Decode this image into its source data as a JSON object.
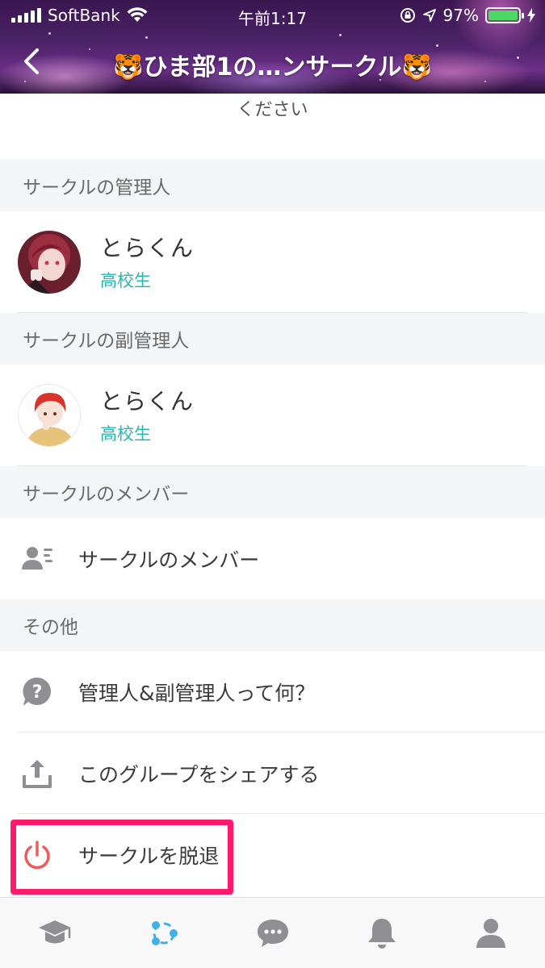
{
  "status_bar": {
    "carrier": "SoftBank",
    "time": "午前1:17",
    "battery": "97%",
    "battery_level": 0.97
  },
  "nav": {
    "title": "🐯ひま部1の…ンサークル🐯"
  },
  "description_tail": "ください",
  "admin_section": {
    "header": "サークルの管理人",
    "name": "とらくん",
    "grade": "高校生"
  },
  "subadmin_section": {
    "header": "サークルの副管理人",
    "name": "とらくん",
    "grade": "高校生"
  },
  "members_section": {
    "header": "サークルのメンバー",
    "row_label": "サークルのメンバー",
    "icon": "member-list-icon"
  },
  "other_section": {
    "header": "その他",
    "items": [
      {
        "label": "管理人&副管理人って何？",
        "icon": "question-bubble-icon"
      },
      {
        "label": "このグループをシェアする",
        "icon": "share-upload-icon"
      },
      {
        "label": "サークルを脱退",
        "icon": "power-icon"
      }
    ]
  },
  "tab_bar": {
    "tabs": [
      {
        "icon": "graduation-cap-icon",
        "active": false
      },
      {
        "icon": "circle-network-icon",
        "active": true
      },
      {
        "icon": "chat-bubble-icon",
        "active": false
      },
      {
        "icon": "bell-icon",
        "active": false
      },
      {
        "icon": "profile-icon",
        "active": false
      }
    ]
  },
  "colors": {
    "accent_teal": "#2bb7ad",
    "highlight_pink": "#ff1a6e",
    "leave_red": "#f05a5a",
    "active_tab_blue": "#3fb0e8",
    "inactive_icon_gray": "#8e8e93",
    "section_bg": "#f4f5f7"
  }
}
